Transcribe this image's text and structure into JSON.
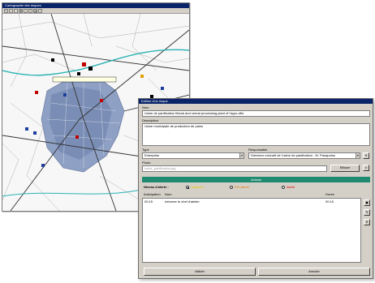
{
  "map_window": {
    "title": "Cartographie des risques",
    "toolbar_icons": [
      "pointer-icon",
      "zoom-in-icon",
      "zoom-out-icon",
      "pan-icon",
      "info-icon",
      "layers-icon",
      "print-icon",
      "help-icon"
    ],
    "colors": {
      "urban": "#8ea0c4",
      "road": "#333333",
      "river": "#2bb3b3",
      "ground": "#f7f7f7"
    }
  },
  "editor": {
    "title": "Edition d'un risque",
    "name_label": "Nom",
    "name_value": "Usine de panification Bread and cereal processing plant of l'agro-ville",
    "description_label": "Description",
    "description_value": "Usine municipale de production de pains",
    "type_label": "Type",
    "type_value": "Entreprise",
    "responsible_label": "Responsable",
    "responsible_value": "Directeur exécutif de l'usine de panification - M. Panapolos",
    "photo_label": "Photo",
    "photo_placeholder": "usine_panification.jpg",
    "clear_button": "Effacer",
    "actions_header": "Actions",
    "alert_level_label": "Niveau d'alerte :",
    "alert_levels": [
      {
        "label": "Vigilance",
        "color": "#e8c400",
        "selected": true
      },
      {
        "label": "Pre-Alerte",
        "color": "#e07800",
        "selected": false
      },
      {
        "label": "Alerte",
        "color": "#e00000",
        "selected": false
      }
    ],
    "columns": [
      "Anticipation",
      "Nom",
      "Durée"
    ],
    "rows": [
      {
        "anticipation": "00:15",
        "nom": "Informer le chef d'atelier",
        "duree": "00:15"
      }
    ],
    "validate_button": "Valider",
    "cancel_button": "Annuler"
  }
}
